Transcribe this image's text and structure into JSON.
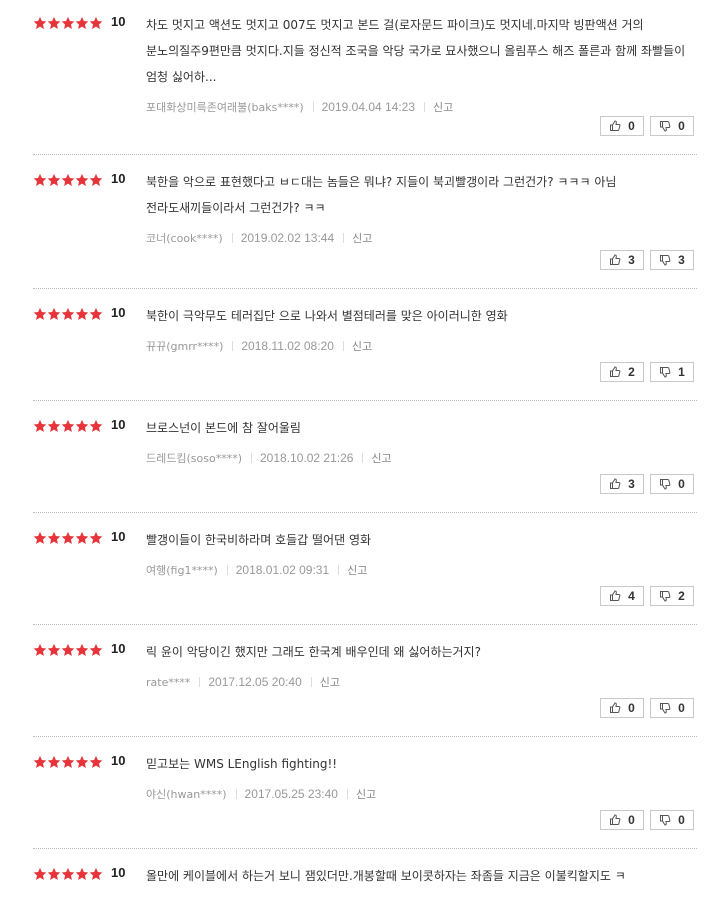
{
  "colors": {
    "star": "#e5353a",
    "divider": "#bbbbbb",
    "meta": "#999999"
  },
  "icons": {
    "star": "star-icon",
    "like": "thumbs-up-icon",
    "dislike": "thumbs-down-icon"
  },
  "reviews": [
    {
      "stars": 5,
      "score": "10",
      "text": "차도 멋지고 액션도 멋지고 007도 멋지고 본드 걸(로자문드 파이크)도 멋지네.마지막 빙판액션 거의 분노의질주9편만큼 멋지다.지들 정신적 조국을 악당 국가로 묘사했으니 올림푸스 해즈 폴른과 함께 좌빨들이 엄청 싫어하...",
      "nick": "포대화상미륵존여래불(baks****)",
      "date": "2019.04.04 14:23",
      "report": "신고",
      "likes": "0",
      "dislikes": "0"
    },
    {
      "stars": 5,
      "score": "10",
      "text": "북한을 악으로 표현했다고 ㅂㄷ대는 놈들은 뭐냐? 지들이 북괴빨갱이라 그런건가? ㅋㅋㅋ 아님 전라도새끼들이라서 그런건가? ㅋㅋ",
      "nick": "코너(cook****)",
      "date": "2019.02.02 13:44",
      "report": "신고",
      "likes": "3",
      "dislikes": "3"
    },
    {
      "stars": 5,
      "score": "10",
      "text": "북한이 극악무도 테러집단 으로 나와서 별점테러를 맞은 아이러니한 영화",
      "nick": "뀨뀨(gmrr****)",
      "date": "2018.11.02 08:20",
      "report": "신고",
      "likes": "2",
      "dislikes": "1"
    },
    {
      "stars": 5,
      "score": "10",
      "text": "브로스넌이 본드에 참 잘어울림",
      "nick": "드레드킴(soso****)",
      "date": "2018.10.02 21:26",
      "report": "신고",
      "likes": "3",
      "dislikes": "0"
    },
    {
      "stars": 5,
      "score": "10",
      "text": "빨갱이들이 한국비하라며 호들갑 떨어댄 영화",
      "nick": "여행(fig1****)",
      "date": "2018.01.02 09:31",
      "report": "신고",
      "likes": "4",
      "dislikes": "2"
    },
    {
      "stars": 5,
      "score": "10",
      "text": "릭 윤이 악당이긴 했지만 그래도 한국계 배우인데 왜 싫어하는거지?",
      "nick": "rate****",
      "date": "2017.12.05 20:40",
      "report": "신고",
      "likes": "0",
      "dislikes": "0"
    },
    {
      "stars": 5,
      "score": "10",
      "text": "믿고보는 WMS LEnglish fighting!!",
      "nick": "야신(hwan****)",
      "date": "2017.05.25 23:40",
      "report": "신고",
      "likes": "0",
      "dislikes": "0"
    },
    {
      "stars": 5,
      "score": "10",
      "text": "올만에 케이블에서 하는거 보니 잼있더만.개봉할때 보이콧하자는 좌좀들 지금은 이불킥할지도 ㅋ",
      "nick": "",
      "date": "",
      "report": "",
      "likes": "",
      "dislikes": ""
    }
  ]
}
